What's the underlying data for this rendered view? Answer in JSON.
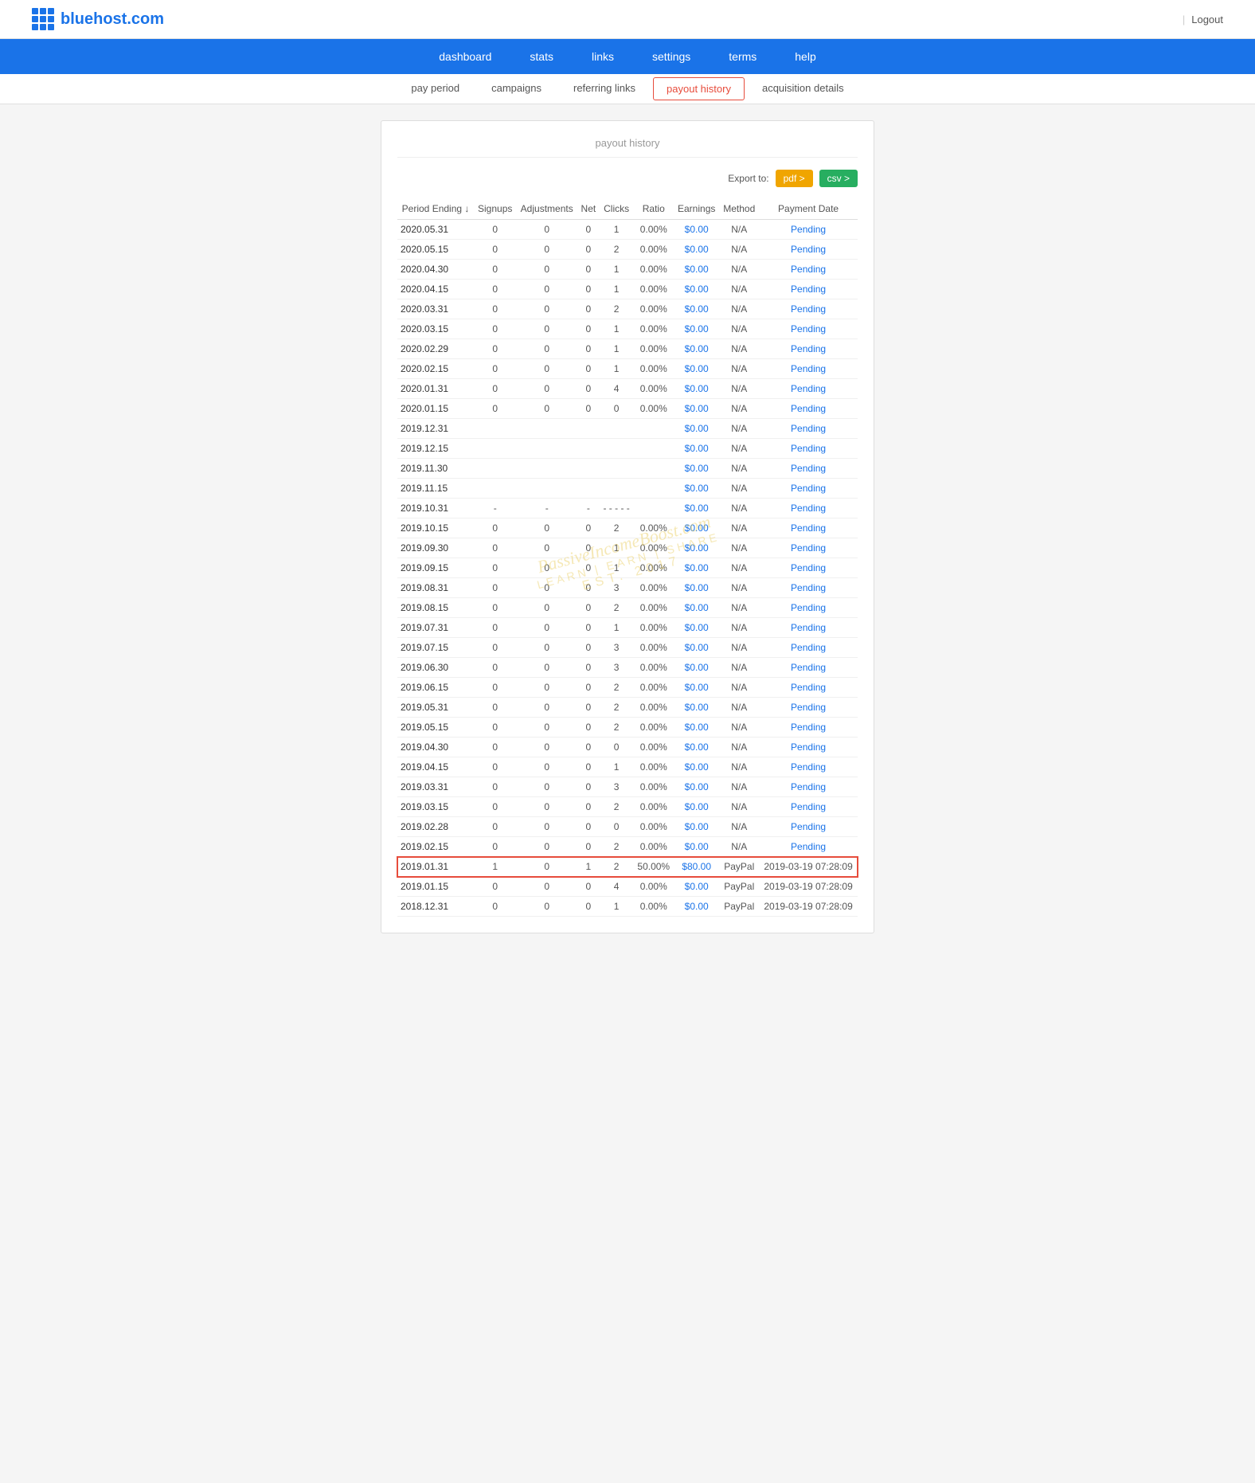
{
  "header": {
    "logo_text": "bluehost.com",
    "logout_label": "Logout"
  },
  "main_nav": {
    "items": [
      {
        "label": "dashboard",
        "href": "#"
      },
      {
        "label": "stats",
        "href": "#"
      },
      {
        "label": "links",
        "href": "#"
      },
      {
        "label": "settings",
        "href": "#"
      },
      {
        "label": "terms",
        "href": "#"
      },
      {
        "label": "help",
        "href": "#"
      }
    ]
  },
  "sub_nav": {
    "items": [
      {
        "label": "pay period",
        "active": false
      },
      {
        "label": "campaigns",
        "active": false
      },
      {
        "label": "referring links",
        "active": false
      },
      {
        "label": "payout history",
        "active": true
      },
      {
        "label": "acquisition details",
        "active": false
      }
    ]
  },
  "section_title": "payout history",
  "export": {
    "label": "Export to:",
    "pdf_label": "pdf >",
    "csv_label": "csv >"
  },
  "table": {
    "headers": [
      "Period Ending ↓",
      "Signups",
      "Adjustments",
      "Net",
      "Clicks",
      "Ratio",
      "Earnings",
      "Method",
      "Payment Date"
    ],
    "rows": [
      {
        "period": "2020.05.31",
        "signups": "0",
        "adjustments": "0",
        "net": "0",
        "clicks": "1",
        "ratio": "0.00%",
        "earnings": "$0.00",
        "method": "N/A",
        "payment_date": "Pending",
        "highlight": false
      },
      {
        "period": "2020.05.15",
        "signups": "0",
        "adjustments": "0",
        "net": "0",
        "clicks": "2",
        "ratio": "0.00%",
        "earnings": "$0.00",
        "method": "N/A",
        "payment_date": "Pending",
        "highlight": false
      },
      {
        "period": "2020.04.30",
        "signups": "0",
        "adjustments": "0",
        "net": "0",
        "clicks": "1",
        "ratio": "0.00%",
        "earnings": "$0.00",
        "method": "N/A",
        "payment_date": "Pending",
        "highlight": false
      },
      {
        "period": "2020.04.15",
        "signups": "0",
        "adjustments": "0",
        "net": "0",
        "clicks": "1",
        "ratio": "0.00%",
        "earnings": "$0.00",
        "method": "N/A",
        "payment_date": "Pending",
        "highlight": false
      },
      {
        "period": "2020.03.31",
        "signups": "0",
        "adjustments": "0",
        "net": "0",
        "clicks": "2",
        "ratio": "0.00%",
        "earnings": "$0.00",
        "method": "N/A",
        "payment_date": "Pending",
        "highlight": false
      },
      {
        "period": "2020.03.15",
        "signups": "0",
        "adjustments": "0",
        "net": "0",
        "clicks": "1",
        "ratio": "0.00%",
        "earnings": "$0.00",
        "method": "N/A",
        "payment_date": "Pending",
        "highlight": false
      },
      {
        "period": "2020.02.29",
        "signups": "0",
        "adjustments": "0",
        "net": "0",
        "clicks": "1",
        "ratio": "0.00%",
        "earnings": "$0.00",
        "method": "N/A",
        "payment_date": "Pending",
        "highlight": false
      },
      {
        "period": "2020.02.15",
        "signups": "0",
        "adjustments": "0",
        "net": "0",
        "clicks": "1",
        "ratio": "0.00%",
        "earnings": "$0.00",
        "method": "N/A",
        "payment_date": "Pending",
        "highlight": false
      },
      {
        "period": "2020.01.31",
        "signups": "0",
        "adjustments": "0",
        "net": "0",
        "clicks": "4",
        "ratio": "0.00%",
        "earnings": "$0.00",
        "method": "N/A",
        "payment_date": "Pending",
        "highlight": false
      },
      {
        "period": "2020.01.15",
        "signups": "0",
        "adjustments": "0",
        "net": "0",
        "clicks": "0",
        "ratio": "0.00%",
        "earnings": "$0.00",
        "method": "N/A",
        "payment_date": "Pending",
        "highlight": false
      },
      {
        "period": "2019.12.31",
        "signups": "",
        "adjustments": "",
        "net": "",
        "clicks": "",
        "ratio": "",
        "earnings": "$0.00",
        "method": "N/A",
        "payment_date": "Pending",
        "highlight": false
      },
      {
        "period": "2019.12.15",
        "signups": "",
        "adjustments": "",
        "net": "",
        "clicks": "",
        "ratio": "",
        "earnings": "$0.00",
        "method": "N/A",
        "payment_date": "Pending",
        "highlight": false
      },
      {
        "period": "2019.11.30",
        "signups": "",
        "adjustments": "",
        "net": "",
        "clicks": "",
        "ratio": "",
        "earnings": "$0.00",
        "method": "N/A",
        "payment_date": "Pending",
        "highlight": false
      },
      {
        "period": "2019.11.15",
        "signups": "",
        "adjustments": "",
        "net": "",
        "clicks": "",
        "ratio": "",
        "earnings": "$0.00",
        "method": "N/A",
        "payment_date": "Pending",
        "highlight": false
      },
      {
        "period": "2019.10.31",
        "signups": "-",
        "adjustments": "-",
        "net": "-",
        "clicks": "- - - - -",
        "ratio": "",
        "earnings": "$0.00",
        "method": "N/A",
        "payment_date": "Pending",
        "highlight": false
      },
      {
        "period": "2019.10.15",
        "signups": "0",
        "adjustments": "0",
        "net": "0",
        "clicks": "2",
        "ratio": "0.00%",
        "earnings": "$0.00",
        "method": "N/A",
        "payment_date": "Pending",
        "highlight": false
      },
      {
        "period": "2019.09.30",
        "signups": "0",
        "adjustments": "0",
        "net": "0",
        "clicks": "1",
        "ratio": "0.00%",
        "earnings": "$0.00",
        "method": "N/A",
        "payment_date": "Pending",
        "highlight": false
      },
      {
        "period": "2019.09.15",
        "signups": "0",
        "adjustments": "0",
        "net": "0",
        "clicks": "1",
        "ratio": "0.00%",
        "earnings": "$0.00",
        "method": "N/A",
        "payment_date": "Pending",
        "highlight": false
      },
      {
        "period": "2019.08.31",
        "signups": "0",
        "adjustments": "0",
        "net": "0",
        "clicks": "3",
        "ratio": "0.00%",
        "earnings": "$0.00",
        "method": "N/A",
        "payment_date": "Pending",
        "highlight": false
      },
      {
        "period": "2019.08.15",
        "signups": "0",
        "adjustments": "0",
        "net": "0",
        "clicks": "2",
        "ratio": "0.00%",
        "earnings": "$0.00",
        "method": "N/A",
        "payment_date": "Pending",
        "highlight": false
      },
      {
        "period": "2019.07.31",
        "signups": "0",
        "adjustments": "0",
        "net": "0",
        "clicks": "1",
        "ratio": "0.00%",
        "earnings": "$0.00",
        "method": "N/A",
        "payment_date": "Pending",
        "highlight": false
      },
      {
        "period": "2019.07.15",
        "signups": "0",
        "adjustments": "0",
        "net": "0",
        "clicks": "3",
        "ratio": "0.00%",
        "earnings": "$0.00",
        "method": "N/A",
        "payment_date": "Pending",
        "highlight": false
      },
      {
        "period": "2019.06.30",
        "signups": "0",
        "adjustments": "0",
        "net": "0",
        "clicks": "3",
        "ratio": "0.00%",
        "earnings": "$0.00",
        "method": "N/A",
        "payment_date": "Pending",
        "highlight": false
      },
      {
        "period": "2019.06.15",
        "signups": "0",
        "adjustments": "0",
        "net": "0",
        "clicks": "2",
        "ratio": "0.00%",
        "earnings": "$0.00",
        "method": "N/A",
        "payment_date": "Pending",
        "highlight": false
      },
      {
        "period": "2019.05.31",
        "signups": "0",
        "adjustments": "0",
        "net": "0",
        "clicks": "2",
        "ratio": "0.00%",
        "earnings": "$0.00",
        "method": "N/A",
        "payment_date": "Pending",
        "highlight": false
      },
      {
        "period": "2019.05.15",
        "signups": "0",
        "adjustments": "0",
        "net": "0",
        "clicks": "2",
        "ratio": "0.00%",
        "earnings": "$0.00",
        "method": "N/A",
        "payment_date": "Pending",
        "highlight": false
      },
      {
        "period": "2019.04.30",
        "signups": "0",
        "adjustments": "0",
        "net": "0",
        "clicks": "0",
        "ratio": "0.00%",
        "earnings": "$0.00",
        "method": "N/A",
        "payment_date": "Pending",
        "highlight": false
      },
      {
        "period": "2019.04.15",
        "signups": "0",
        "adjustments": "0",
        "net": "0",
        "clicks": "1",
        "ratio": "0.00%",
        "earnings": "$0.00",
        "method": "N/A",
        "payment_date": "Pending",
        "highlight": false
      },
      {
        "period": "2019.03.31",
        "signups": "0",
        "adjustments": "0",
        "net": "0",
        "clicks": "3",
        "ratio": "0.00%",
        "earnings": "$0.00",
        "method": "N/A",
        "payment_date": "Pending",
        "highlight": false
      },
      {
        "period": "2019.03.15",
        "signups": "0",
        "adjustments": "0",
        "net": "0",
        "clicks": "2",
        "ratio": "0.00%",
        "earnings": "$0.00",
        "method": "N/A",
        "payment_date": "Pending",
        "highlight": false
      },
      {
        "period": "2019.02.28",
        "signups": "0",
        "adjustments": "0",
        "net": "0",
        "clicks": "0",
        "ratio": "0.00%",
        "earnings": "$0.00",
        "method": "N/A",
        "payment_date": "Pending",
        "highlight": false
      },
      {
        "period": "2019.02.15",
        "signups": "0",
        "adjustments": "0",
        "net": "0",
        "clicks": "2",
        "ratio": "0.00%",
        "earnings": "$0.00",
        "method": "N/A",
        "payment_date": "Pending",
        "highlight": false
      },
      {
        "period": "2019.01.31",
        "signups": "1",
        "adjustments": "0",
        "net": "1",
        "clicks": "2",
        "ratio": "50.00%",
        "earnings": "$80.00",
        "method": "PayPal",
        "payment_date": "2019-03-19 07:28:09",
        "highlight": true
      },
      {
        "period": "2019.01.15",
        "signups": "0",
        "adjustments": "0",
        "net": "0",
        "clicks": "4",
        "ratio": "0.00%",
        "earnings": "$0.00",
        "method": "PayPal",
        "payment_date": "2019-03-19 07:28:09",
        "highlight": false
      },
      {
        "period": "2018.12.31",
        "signups": "0",
        "adjustments": "0",
        "net": "0",
        "clicks": "1",
        "ratio": "0.00%",
        "earnings": "$0.00",
        "method": "PayPal",
        "payment_date": "2019-03-19 07:28:09",
        "highlight": false
      }
    ]
  }
}
